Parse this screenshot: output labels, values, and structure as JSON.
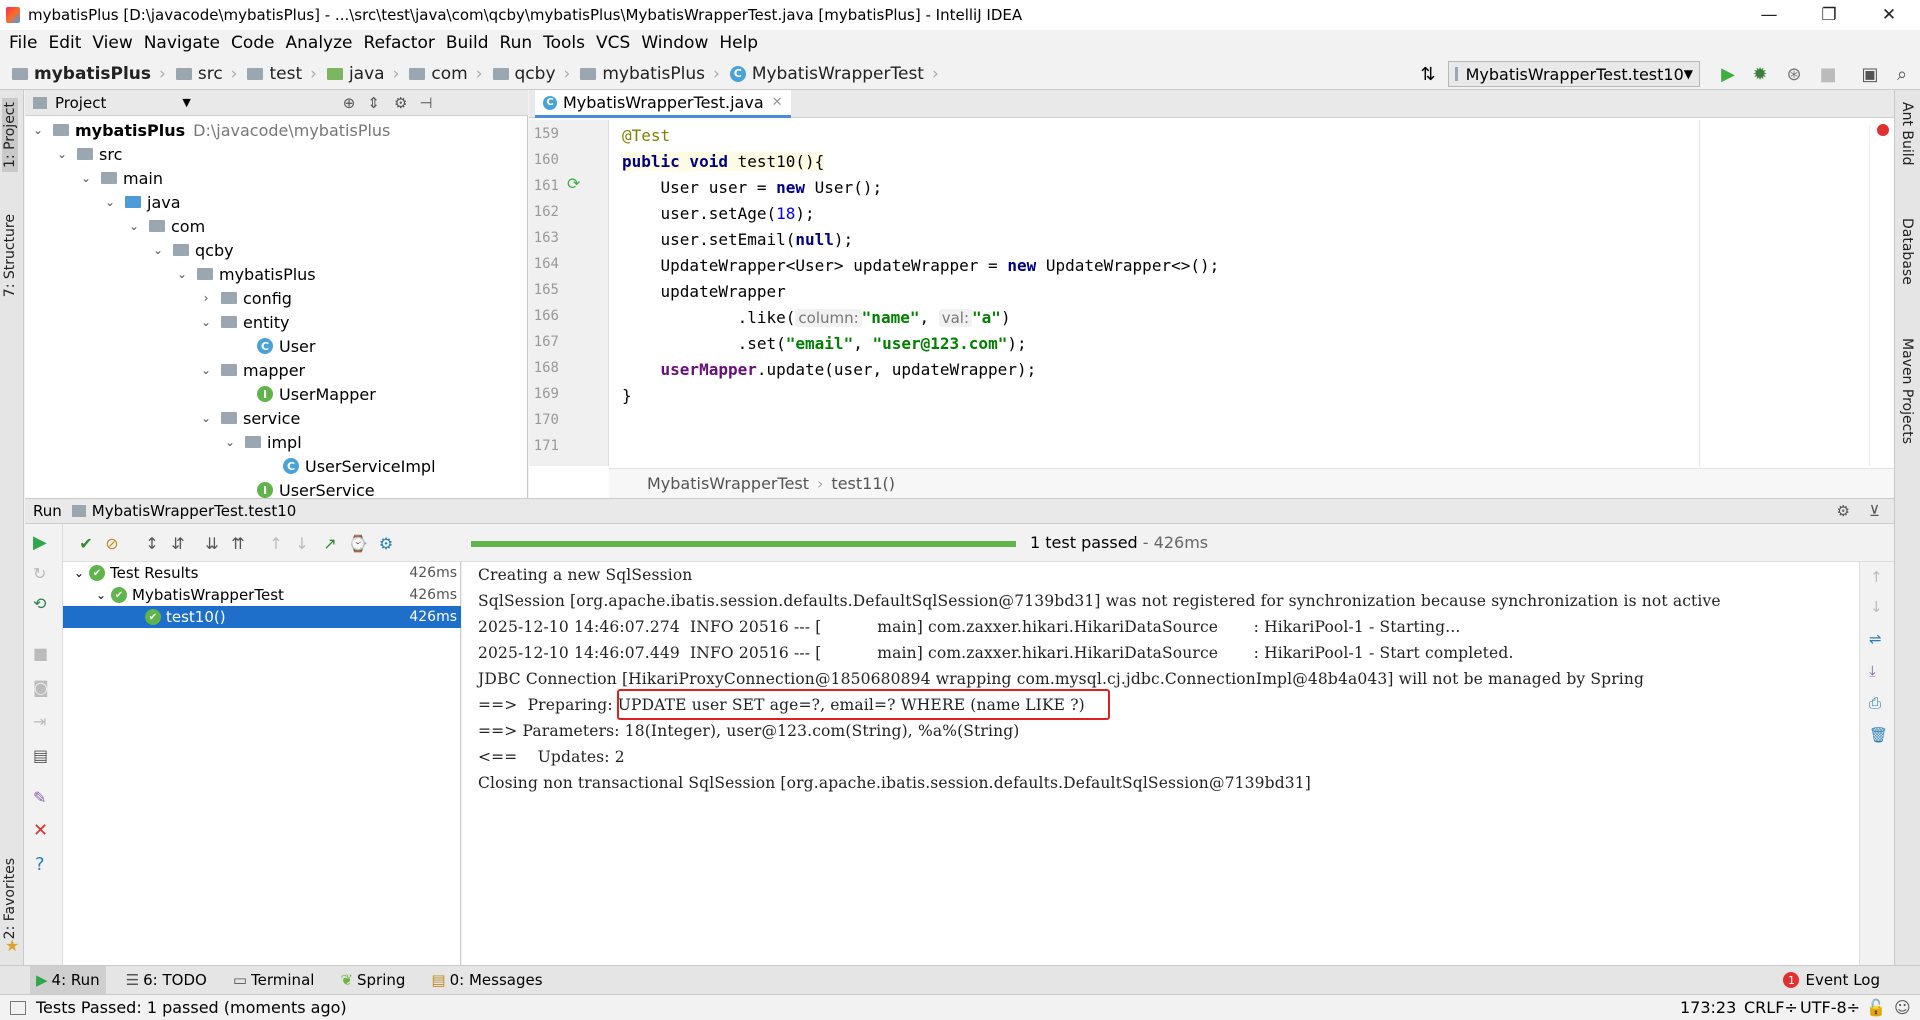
{
  "window": {
    "title": "mybatisPlus [D:\\javacode\\mybatisPlus] - ...\\src\\test\\java\\com\\qcby\\mybatisPlus\\MybatisWrapperTest.java [mybatisPlus] - IntelliJ IDEA"
  },
  "menu": [
    "File",
    "Edit",
    "View",
    "Navigate",
    "Code",
    "Analyze",
    "Refactor",
    "Build",
    "Run",
    "Tools",
    "VCS",
    "Window",
    "Help"
  ],
  "nav": {
    "crumbs": [
      "mybatisPlus",
      "src",
      "test",
      "java",
      "com",
      "qcby",
      "mybatisPlus",
      "MybatisWrapperTest"
    ],
    "run_config": "MybatisWrapperTest.test10"
  },
  "project": {
    "header": "Project",
    "root_path": "D:\\javacode\\mybatisPlus",
    "tree": [
      "mybatisPlus",
      "src",
      "main",
      "java",
      "com",
      "qcby",
      "mybatisPlus",
      "config",
      "entity",
      "User",
      "mapper",
      "UserMapper",
      "service",
      "impl",
      "UserServiceImpl",
      "UserService"
    ]
  },
  "editor": {
    "tab": "MybatisWrapperTest.java",
    "line_numbers": [
      "159",
      "160",
      "161",
      "162",
      "163",
      "164",
      "165",
      "166",
      "167",
      "168",
      "169",
      "170",
      "171"
    ],
    "breadcrumb": [
      "MybatisWrapperTest",
      "test11()"
    ],
    "code": {
      "l160": "@Test",
      "l161a": "public void",
      "l161b": " test10(){",
      "l162a": "    User user = ",
      "l162b": "new",
      "l162c": " User();",
      "l163a": "    user.setAge(",
      "l163b": "18",
      "l163c": ");",
      "l164a": "    user.setEmail(",
      "l164b": "null",
      "l164c": ");",
      "l165a": "    UpdateWrapper<User> updateWrapper = ",
      "l165b": "new",
      "l165c": " UpdateWrapper<>();",
      "l166": "    updateWrapper",
      "l167a": "            .like(",
      "l167h1": "column:",
      "l167b": "\"name\"",
      "l167c": ", ",
      "l167h2": "val:",
      "l167d": "\"a\"",
      "l167e": ")",
      "l168a": "            .set(",
      "l168b": "\"email\"",
      "l168c": ", ",
      "l168d": "\"user@123.com\"",
      "l168e": ");",
      "l169a": "    userMapper",
      "l169b": ".update(user, updateWrapper);",
      "l170": "}"
    }
  },
  "run": {
    "header_label": "Run",
    "config": "MybatisWrapperTest.test10",
    "status": "1 test passed",
    "status_time": " - 426ms",
    "progress": 1.0,
    "tests": [
      {
        "name": "Test Results",
        "duration": "426ms"
      },
      {
        "name": "MybatisWrapperTest",
        "duration": "426ms"
      },
      {
        "name": "test10()",
        "duration": "426ms"
      }
    ],
    "console": [
      "Creating a new SqlSession",
      "SqlSession [org.apache.ibatis.session.defaults.DefaultSqlSession@7139bd31] was not registered for synchronization because synchronization is not active",
      "2025-12-10 14:46:07.274  INFO 20516 --- [           main] com.zaxxer.hikari.HikariDataSource       : HikariPool-1 - Starting...",
      "2025-12-10 14:46:07.449  INFO 20516 --- [           main] com.zaxxer.hikari.HikariDataSource       : HikariPool-1 - Start completed.",
      "JDBC Connection [HikariProxyConnection@1850680894 wrapping com.mysql.cj.jdbc.ConnectionImpl@48b4a043] will not be managed by Spring",
      "==>  Preparing: UPDATE user SET age=?, email=? WHERE (name LIKE ?)",
      "==> Parameters: 18(Integer), user@123.com(String), %a%(String)",
      "<==    Updates: 2",
      "Closing non transactional SqlSession [org.apache.ibatis.session.defaults.DefaultSqlSession@7139bd31]"
    ]
  },
  "tool_windows": {
    "left": [
      "1: Project",
      "7: Structure",
      "2: Favorites"
    ],
    "right": [
      "Ant Build",
      "Database",
      "Maven Projects"
    ]
  },
  "bottom_tabs": [
    "4: Run",
    "6: TODO",
    "Terminal",
    "Spring",
    "0: Messages"
  ],
  "event_log": {
    "count": "1",
    "label": "Event Log"
  },
  "status": {
    "message": "Tests Passed: 1 passed (moments ago)",
    "position": "173:23",
    "line_sep": "CRLF÷",
    "encoding": "UTF-8÷"
  },
  "colors": {
    "accent": "#4a8de0",
    "pass": "#5fb44b",
    "highlight": "#e02020",
    "selection": "#1e6fc9"
  }
}
